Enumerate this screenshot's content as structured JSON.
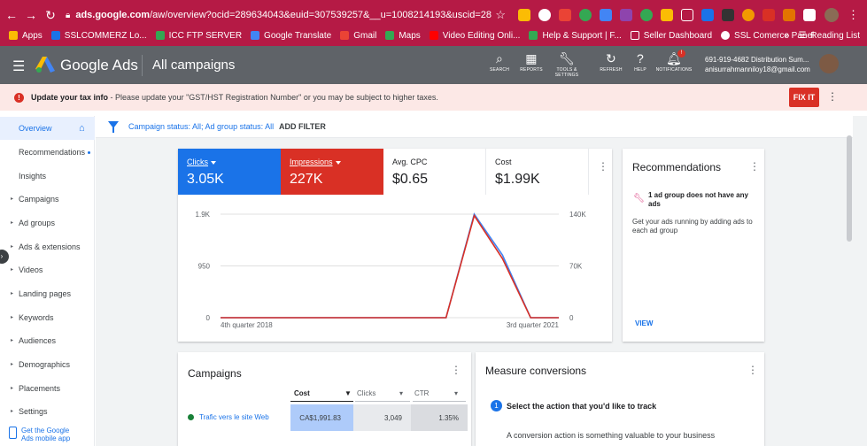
{
  "browser": {
    "url_domain": "ads.google.com",
    "url_path": "/aw/overview?ocid=289634043&euid=307539257&__u=1008214193&uscid=28963404...",
    "bookmarks": [
      "Apps",
      "SSLCOMMERZ Lo...",
      "ICC FTP SERVER",
      "Google Translate",
      "Gmail",
      "Maps",
      "Video Editing Onli...",
      "Help & Support | F...",
      "Seller Dashboard",
      "SSL Comerce Panel"
    ],
    "reading_list": "Reading List",
    "more_bookmarks": "»"
  },
  "header": {
    "brand": "Google Ads",
    "page_title": "All campaigns",
    "tools": [
      {
        "label": "SEARCH",
        "icon": "search-icon"
      },
      {
        "label": "REPORTS",
        "icon": "reports-icon"
      },
      {
        "label": "TOOLS & SETTINGS",
        "icon": "wrench-icon"
      },
      {
        "label": "REFRESH",
        "icon": "refresh-icon"
      },
      {
        "label": "HELP",
        "icon": "help-icon"
      },
      {
        "label": "NOTIFICATIONS",
        "icon": "bell-icon"
      }
    ],
    "notification_badge": "!",
    "account_id": "691-919-4682 Distribution Sum...",
    "account_email": "anisurrahmanniloy18@gmail.com"
  },
  "tax_banner": {
    "title": "Update your tax info",
    "message": " - Please update your \"GST/HST Registration Number\" or you may be subject to higher taxes.",
    "fix_label": "FIX IT"
  },
  "sidebar": {
    "items": [
      {
        "label": "Overview",
        "active": true,
        "caret": false
      },
      {
        "label": "Recommendations",
        "active": false,
        "caret": false,
        "dot": true
      },
      {
        "label": "Insights",
        "active": false,
        "caret": false
      },
      {
        "label": "Campaigns",
        "active": false,
        "caret": true
      },
      {
        "label": "Ad groups",
        "active": false,
        "caret": true
      },
      {
        "label": "Ads & extensions",
        "active": false,
        "caret": true
      },
      {
        "label": "Videos",
        "active": false,
        "caret": true
      },
      {
        "label": "Landing pages",
        "active": false,
        "caret": true
      },
      {
        "label": "Keywords",
        "active": false,
        "caret": true
      },
      {
        "label": "Audiences",
        "active": false,
        "caret": true
      },
      {
        "label": "Demographics",
        "active": false,
        "caret": true
      },
      {
        "label": "Placements",
        "active": false,
        "caret": true
      },
      {
        "label": "Settings",
        "active": false,
        "caret": true
      }
    ],
    "mobile_app_line1": "Get the Google",
    "mobile_app_line2": "Ads mobile app"
  },
  "filter": {
    "status_text": "Campaign status: All; Ad group status: All",
    "add_filter": "ADD FILTER"
  },
  "metrics": [
    {
      "label": "Clicks",
      "value": "3.05K",
      "bg": "#1a73e8",
      "fg": "#ffffff",
      "dropdown": true
    },
    {
      "label": "Impressions",
      "value": "227K",
      "bg": "#d93025",
      "fg": "#ffffff",
      "dropdown": true
    },
    {
      "label": "Avg. CPC",
      "value": "$0.65",
      "bg": "#ffffff",
      "fg": "#202124",
      "dropdown": false
    },
    {
      "label": "Cost",
      "value": "$1.99K",
      "bg": "#ffffff",
      "fg": "#202124",
      "dropdown": false
    }
  ],
  "chart_data": {
    "type": "line",
    "x": [
      0,
      1,
      2,
      3,
      4,
      5,
      6,
      7,
      8,
      9,
      10,
      11,
      12
    ],
    "x_labels": {
      "first": "4th quarter 2018",
      "last": "3rd quarter 2021"
    },
    "left_ticks": [
      "1.9K",
      "950",
      "0"
    ],
    "right_ticks": [
      "140K",
      "70K",
      "0"
    ],
    "left_ylim": [
      0,
      1900
    ],
    "right_ylim": [
      0,
      140000
    ],
    "series": [
      {
        "name": "Clicks",
        "axis": "left",
        "color": "#4285f4",
        "values": [
          0,
          0,
          0,
          0,
          0,
          0,
          0,
          0,
          0,
          1900,
          1150,
          0,
          0
        ]
      },
      {
        "name": "Impressions",
        "axis": "right",
        "color": "#d93025",
        "values": [
          0,
          0,
          0,
          0,
          0,
          0,
          0,
          0,
          0,
          138000,
          80000,
          0,
          0
        ]
      }
    ],
    "grid": true,
    "legend": "none"
  },
  "recommendations": {
    "title": "Recommendations",
    "item_title": "1 ad group does not have any ads",
    "item_body": "Get your ads running by adding ads to each ad group",
    "view_label": "VIEW"
  },
  "campaigns": {
    "title": "Campaigns",
    "columns": [
      "Cost",
      "Clicks",
      "CTR"
    ],
    "rows": [
      {
        "name": "Trafic vers le site Web",
        "cost": "CA$1,991.83",
        "clicks": "3,049",
        "ctr": "1.35%"
      }
    ]
  },
  "measure": {
    "title": "Measure conversions",
    "step_number": "1",
    "step_title": "Select the action that you'd like to track",
    "step_desc": "A conversion action is something valuable to your business"
  }
}
